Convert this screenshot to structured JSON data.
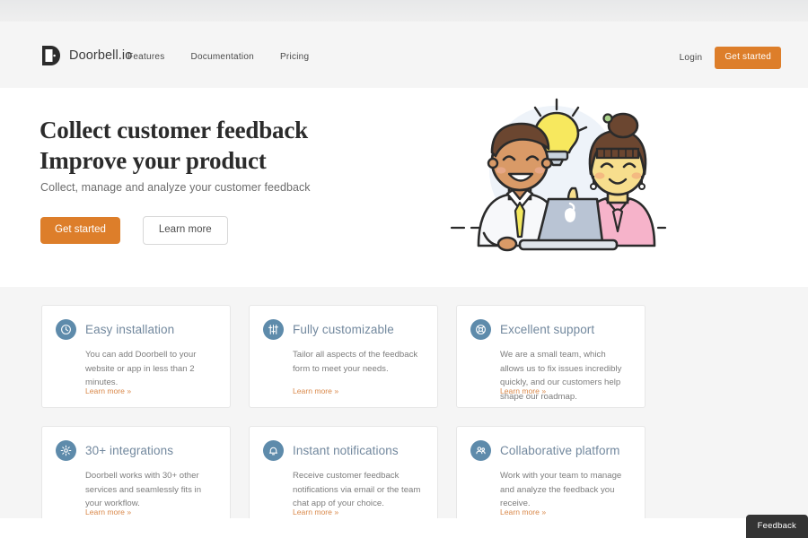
{
  "brand": {
    "name": "Doorbell.io",
    "logo_icon": "doorbell-door-logo-icon"
  },
  "nav": {
    "links": [
      {
        "label": "Features"
      },
      {
        "label": "Documentation"
      },
      {
        "label": "Pricing"
      }
    ],
    "login_label": "Login",
    "cta_label": "Get started"
  },
  "hero": {
    "title_line1": "Collect customer feedback",
    "title_line2": "Improve your product",
    "subtitle": "Collect, manage and analyze your customer feedback",
    "primary_cta": "Get started",
    "secondary_cta": "Learn more",
    "illustration_name": "two-people-laptop-lightbulb-illustration"
  },
  "features": {
    "link_label": "Learn more »",
    "icon_circle_color": "#5e8bab",
    "title_color": "#72889e",
    "link_color": "#d9884a",
    "cards": [
      {
        "icon": "clock-icon",
        "title": "Easy installation",
        "body": "You can add Doorbell to your website or app in less than 2 minutes.",
        "link": "Learn more »"
      },
      {
        "icon": "sliders-icon",
        "title": "Fully customizable",
        "body": "Tailor all aspects of the feedback form to meet your needs.",
        "link": "Learn more »"
      },
      {
        "icon": "lifebuoy-icon",
        "title": "Excellent support",
        "body": "We are a small team, which allows us to fix issues incredibly quickly, and our customers help shape our roadmap.",
        "link": "Learn more »"
      },
      {
        "icon": "gear-icon",
        "title": "30+ integrations",
        "body": "Doorbell works with 30+ other services and seamlessly fits in your workflow.",
        "link": "Learn more »"
      },
      {
        "icon": "bell-icon",
        "title": "Instant notifications",
        "body": "Receive customer feedback notifications via email or the team chat app of your choice.",
        "link": "Learn more »"
      },
      {
        "icon": "users-icon",
        "title": "Collaborative platform",
        "body": "Work with your team to manage and analyze the feedback you receive.",
        "link": "Learn more »"
      }
    ]
  },
  "widget": {
    "feedback_tab_label": "Feedback"
  },
  "colors": {
    "accent_orange": "#dd7e2a",
    "link_orange": "#d9884a",
    "icon_blue": "#5e8bab",
    "heading_dark": "#2b2b2b",
    "page_gray": "#f5f5f5"
  }
}
